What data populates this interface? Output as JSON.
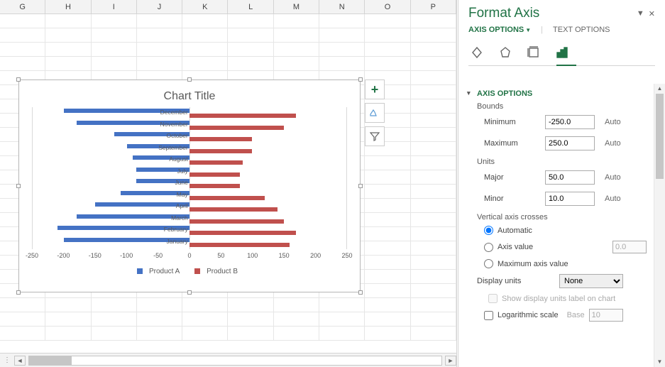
{
  "columns": [
    "G",
    "H",
    "I",
    "J",
    "K",
    "L",
    "M",
    "N",
    "O",
    "P"
  ],
  "chart": {
    "title": "Chart Title",
    "legend_a": "Product A",
    "legend_b": "Product B"
  },
  "chart_data": {
    "type": "bar",
    "title": "Chart Title",
    "xlabel": "",
    "ylabel": "",
    "xlim": [
      -250,
      250
    ],
    "categories": [
      "December",
      "November",
      "October",
      "September",
      "August",
      "July",
      "June",
      "May",
      "April",
      "March",
      "February",
      "January"
    ],
    "series": [
      {
        "name": "Product A",
        "color": "#4472c4",
        "values": [
          -200,
          -180,
          -120,
          -100,
          -90,
          -85,
          -85,
          -110,
          -150,
          -180,
          -210,
          -200
        ]
      },
      {
        "name": "Product B",
        "color": "#c0504d",
        "values": [
          170,
          150,
          100,
          100,
          85,
          80,
          80,
          120,
          140,
          150,
          170,
          160
        ]
      }
    ],
    "x_ticks": [
      -250,
      -200,
      -150,
      -100,
      -50,
      0,
      50,
      100,
      150,
      200,
      250
    ]
  },
  "pane": {
    "title": "Format Axis",
    "tab_axis": "AXIS OPTIONS",
    "tab_text": "TEXT OPTIONS",
    "sect_axis": "AXIS OPTIONS",
    "bounds": "Bounds",
    "min_label": "Minimum",
    "max_label": "Maximum",
    "min_val": "-250.0",
    "max_val": "250.0",
    "units": "Units",
    "major_label": "Major",
    "minor_label": "Minor",
    "major_val": "50.0",
    "minor_val": "10.0",
    "auto": "Auto",
    "vac": "Vertical axis crosses",
    "r_auto": "Automatic",
    "r_val": "Axis value",
    "r_val_num": "0.0",
    "r_max": "Maximum axis value",
    "display_units": "Display units",
    "display_units_val": "None",
    "show_label": "Show display units label on chart",
    "log": "Logarithmic scale",
    "base": "Base",
    "base_val": "10"
  }
}
